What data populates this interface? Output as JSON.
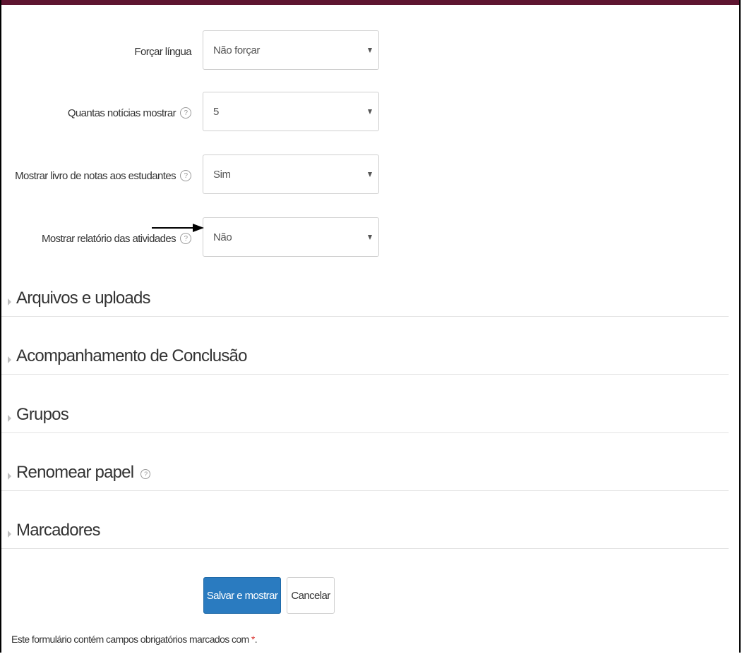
{
  "form": {
    "fields": [
      {
        "label": "Forçar língua",
        "value": "Não forçar",
        "has_help": false
      },
      {
        "label": "Quantas notícias mostrar",
        "value": "5",
        "has_help": true
      },
      {
        "label": "Mostrar livro de notas aos estudantes",
        "value": "Sim",
        "has_help": true
      },
      {
        "label": "Mostrar relatório das atividades",
        "value": "Não",
        "has_help": true
      }
    ],
    "help_glyph": "?"
  },
  "sections": [
    {
      "title": "Arquivos e uploads"
    },
    {
      "title": "Acompanhamento de Conclusão"
    },
    {
      "title": "Grupos"
    },
    {
      "title": "Renomear papel",
      "has_help": true
    },
    {
      "title": "Marcadores"
    }
  ],
  "buttons": {
    "save_label": "Salvar e mostrar",
    "cancel_label": "Cancelar"
  },
  "footer": {
    "required_note": "Este formulário contém campos obrigatórios marcados com",
    "required_marker": "*",
    "required_suffix": "."
  },
  "colors": {
    "top_bar": "#5e1530",
    "primary_button": "#2a7bc0",
    "required_marker": "#d9302c"
  },
  "icons": {
    "help": "help-icon",
    "dropdown": "caret-down-icon",
    "section_toggle": "caret-right-icon",
    "annotation": "arrow-right-icon"
  }
}
